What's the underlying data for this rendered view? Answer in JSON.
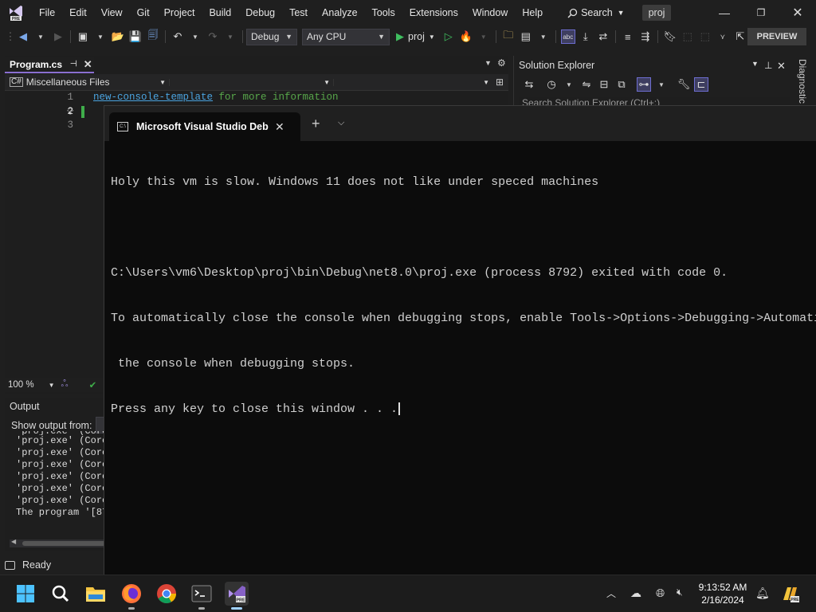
{
  "menu": [
    "File",
    "Edit",
    "View",
    "Git",
    "Project",
    "Build",
    "Debug",
    "Test",
    "Analyze",
    "Tools",
    "Extensions",
    "Window",
    "Help"
  ],
  "search_label": "Search",
  "project_name": "proj",
  "toolbar": {
    "config": "Debug",
    "platform": "Any CPU",
    "run_target": "proj",
    "preview_label": "PREVIEW"
  },
  "editor": {
    "tab_title": "Program.cs",
    "nav_project": "Miscellaneous Files",
    "line_numbers": [
      "1",
      "2",
      "3"
    ],
    "line1_link": "new-console-template",
    "line1_rest": " for more information",
    "zoom": "100 %"
  },
  "output": {
    "title": "Output",
    "show_from_label": "Show output from:",
    "lines": [
      "'proj.exe' (Core",
      "'proj.exe' (Core",
      "'proj.exe' (Core",
      "'proj.exe' (Core",
      "'proj.exe' (Core",
      "'proj.exe' (Core",
      "'proj.exe' (Core",
      "The program '[87"
    ]
  },
  "status": "Ready",
  "solution_explorer": {
    "title": "Solution Explorer",
    "search_placeholder": "Search Solution Explorer (Ctrl+;)"
  },
  "diagnostics_tab": "Diagnostic",
  "console": {
    "tab_title": "Microsoft Visual Studio Debug Console",
    "lines": [
      "Holy this vm is slow. Windows 11 does not like under speced machines",
      "",
      "C:\\Users\\vm6\\Desktop\\proj\\bin\\Debug\\net8.0\\proj.exe (process 8792) exited with code 0.",
      "To automatically close the console when debugging stops, enable Tools->Options->Debugging->Automati",
      " the console when debugging stops.",
      "Press any key to close this window . . ."
    ]
  },
  "taskbar": {
    "time": "9:13:52 AM",
    "date": "2/16/2024"
  },
  "colors": {
    "accent": "#8a6fd1",
    "vs_purple": "#68217a"
  }
}
